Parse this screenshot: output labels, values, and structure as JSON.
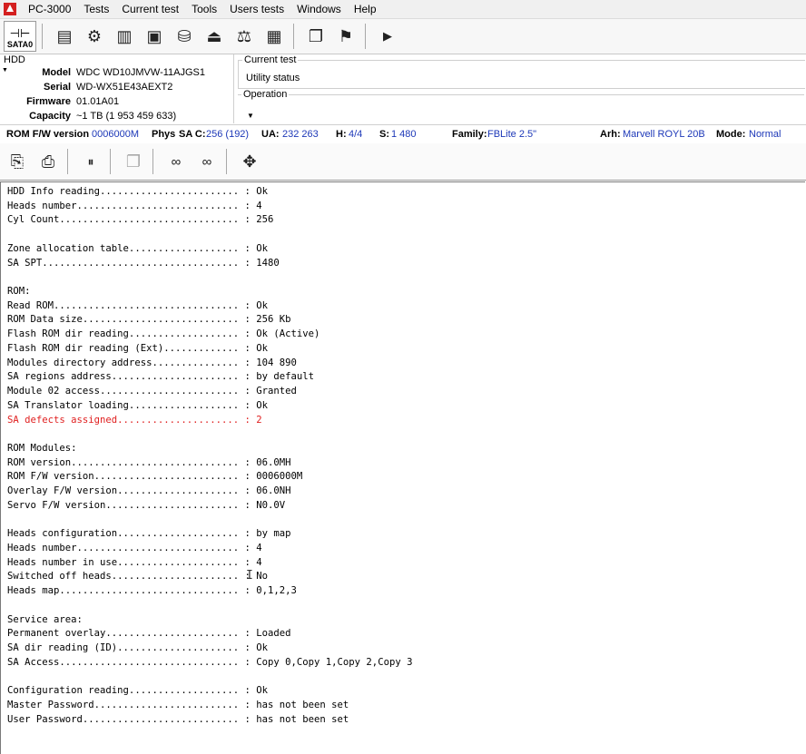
{
  "menubar": {
    "app_title": "PC-3000",
    "items": [
      "Tests",
      "Current test",
      "Tools",
      "Users tests",
      "Windows",
      "Help"
    ]
  },
  "toolbar": {
    "port_label": "SATA0",
    "icons": [
      "hdd-info-icon",
      "settings-gear-icon",
      "chip-icon",
      "module-icon",
      "disk-icon",
      "heads-icon",
      "balance-icon",
      "grid-icon",
      "copy-windows-icon",
      "run-man-icon",
      "play-icon"
    ]
  },
  "hdd": {
    "title": "HDD",
    "model_label": "Model",
    "model": "WDC WD10JMVW-11AJGS1",
    "serial_label": "Serial",
    "serial": "WD-WX51E43AEXT2",
    "firmware_label": "Firmware",
    "firmware": "01.01A01",
    "capacity_label": "Capacity",
    "capacity": "~1 TB (1 953 459 633)"
  },
  "current_test": {
    "label": "Current test",
    "value": "Utility status"
  },
  "operation": {
    "label": "Operation"
  },
  "status": {
    "rom_label": "ROM F/W version",
    "rom_value": "0006000M",
    "phys_label": "Phys",
    "sac_label": "SA C:",
    "sac_value": "256 (192)",
    "ua_label": "UA:",
    "ua_value": "232 263",
    "h_label": "H:",
    "h_value": "4/4",
    "s_label": "S:",
    "s_value": "1 480",
    "family_label": "Family:",
    "family_value": "FBLite 2.5\"",
    "arh_label": "Arh:",
    "arh_value": "Marvell ROYL 20B",
    "mode_label": "Mode:",
    "mode_value": "Normal"
  },
  "colors": {
    "accent_blue": "#1d38b8",
    "error_red": "#e02020"
  },
  "log": {
    "lines": [
      {
        "text": "HDD Info reading........................ : Ok",
        "red": false
      },
      {
        "text": "Heads number............................ : 4",
        "red": false
      },
      {
        "text": "Cyl Count............................... : 256",
        "red": false
      },
      {
        "text": "",
        "red": false
      },
      {
        "text": "Zone allocation table................... : Ok",
        "red": false
      },
      {
        "text": "SA SPT.................................. : 1480",
        "red": false
      },
      {
        "text": "",
        "red": false
      },
      {
        "text": "ROM:",
        "red": false
      },
      {
        "text": "Read ROM................................ : Ok",
        "red": false
      },
      {
        "text": "ROM Data size........................... : 256 Kb",
        "red": false
      },
      {
        "text": "Flash ROM dir reading................... : Ok (Active)",
        "red": false
      },
      {
        "text": "Flash ROM dir reading (Ext)............. : Ok",
        "red": false
      },
      {
        "text": "Modules directory address............... : 104 890",
        "red": false
      },
      {
        "text": "SA regions address...................... : by default",
        "red": false
      },
      {
        "text": "Module 02 access........................ : Granted",
        "red": false
      },
      {
        "text": "SA Translator loading................... : Ok",
        "red": false
      },
      {
        "text": "SA defects assigned..................... : 2",
        "red": true
      },
      {
        "text": "",
        "red": false
      },
      {
        "text": "ROM Modules:",
        "red": false
      },
      {
        "text": "ROM version............................. : 06.0MH",
        "red": false
      },
      {
        "text": "ROM F/W version......................... : 0006000M",
        "red": false
      },
      {
        "text": "Overlay F/W version..................... : 06.0NH",
        "red": false
      },
      {
        "text": "Servo F/W version....................... : N0.0V",
        "red": false
      },
      {
        "text": "",
        "red": false
      },
      {
        "text": "Heads configuration..................... : by map",
        "red": false
      },
      {
        "text": "Heads number............................ : 4",
        "red": false
      },
      {
        "text": "Heads number in use..................... : 4",
        "red": false
      },
      {
        "text": "Switched off heads...................... : No",
        "red": false
      },
      {
        "text": "Heads map............................... : 0,1,2,3",
        "red": false
      },
      {
        "text": "",
        "red": false
      },
      {
        "text": "Service area:",
        "red": false
      },
      {
        "text": "Permanent overlay....................... : Loaded",
        "red": false
      },
      {
        "text": "SA dir reading (ID)..................... : Ok",
        "red": false
      },
      {
        "text": "SA Access............................... : Copy 0,Copy 1,Copy 2,Copy 3",
        "red": false
      },
      {
        "text": "",
        "red": false
      },
      {
        "text": "Configuration reading................... : Ok",
        "red": false
      },
      {
        "text": "Master Password......................... : has not been set",
        "red": false
      },
      {
        "text": "User Password........................... : has not been set",
        "red": false
      }
    ]
  }
}
